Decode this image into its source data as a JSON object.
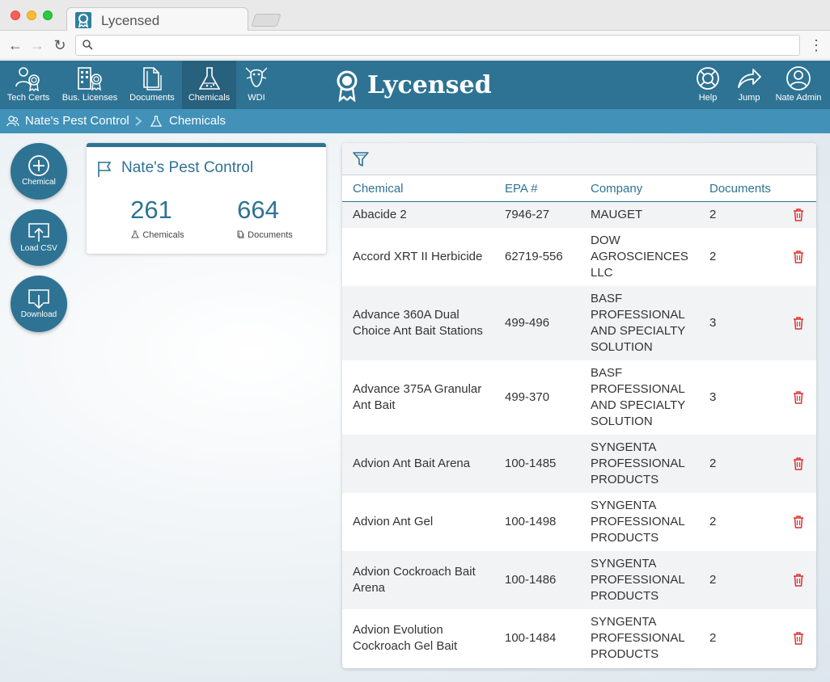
{
  "browser": {
    "tab_title": "Lycensed",
    "address_value": ""
  },
  "header": {
    "brand": "Lycensed",
    "nav": [
      {
        "label": "Tech Certs",
        "icon": "certified-people-icon"
      },
      {
        "label": "Bus. Licenses",
        "icon": "building-certificate-icon"
      },
      {
        "label": "Documents",
        "icon": "documents-icon"
      },
      {
        "label": "Chemicals",
        "icon": "flask-icon",
        "active": true
      },
      {
        "label": "WDI",
        "icon": "termite-icon"
      }
    ],
    "right_nav": [
      {
        "label": "Help",
        "icon": "lifebuoy-icon"
      },
      {
        "label": "Jump",
        "icon": "share-arrow-icon"
      },
      {
        "label": "Nate Admin",
        "icon": "user-icon"
      }
    ]
  },
  "breadcrumb": {
    "company": "Nate's Pest Control",
    "section": "Chemicals"
  },
  "actions": [
    {
      "label": "Chemical",
      "icon": "plus-circle-icon"
    },
    {
      "label": "Load CSV",
      "icon": "upload-icon"
    },
    {
      "label": "Download",
      "icon": "download-icon"
    }
  ],
  "stats": {
    "title": "Nate's Pest Control",
    "chemicals_count": "261",
    "chemicals_label": "Chemicals",
    "documents_count": "664",
    "documents_label": "Documents"
  },
  "table": {
    "columns": [
      "Chemical",
      "EPA #",
      "Company",
      "Documents"
    ],
    "rows": [
      {
        "chemical": "Abacide 2",
        "epa": "7946-27",
        "company": "MAUGET",
        "documents": "2"
      },
      {
        "chemical": "Accord XRT II Herbicide",
        "epa": "62719-556",
        "company": "DOW AGROSCIENCES LLC",
        "documents": "2"
      },
      {
        "chemical": "Advance 360A Dual Choice Ant Bait Stations",
        "epa": "499-496",
        "company": "BASF PROFESSIONAL AND SPECIALTY SOLUTION",
        "documents": "3"
      },
      {
        "chemical": "Advance 375A Granular Ant Bait",
        "epa": "499-370",
        "company": "BASF PROFESSIONAL AND SPECIALTY SOLUTION",
        "documents": "3"
      },
      {
        "chemical": "Advion Ant Bait Arena",
        "epa": "100-1485",
        "company": "SYNGENTA PROFESSIONAL PRODUCTS",
        "documents": "2"
      },
      {
        "chemical": "Advion Ant Gel",
        "epa": "100-1498",
        "company": "SYNGENTA PROFESSIONAL PRODUCTS",
        "documents": "2"
      },
      {
        "chemical": "Advion Cockroach Bait Arena",
        "epa": "100-1486",
        "company": "SYNGENTA PROFESSIONAL PRODUCTS",
        "documents": "2"
      },
      {
        "chemical": "Advion Evolution Cockroach Gel Bait",
        "epa": "100-1484",
        "company": "SYNGENTA PROFESSIONAL PRODUCTS",
        "documents": "2"
      }
    ]
  },
  "colors": {
    "primary": "#2e7393",
    "breadcrumb": "#4191b8",
    "active_nav": "#28617d",
    "delete": "#e0302f"
  }
}
